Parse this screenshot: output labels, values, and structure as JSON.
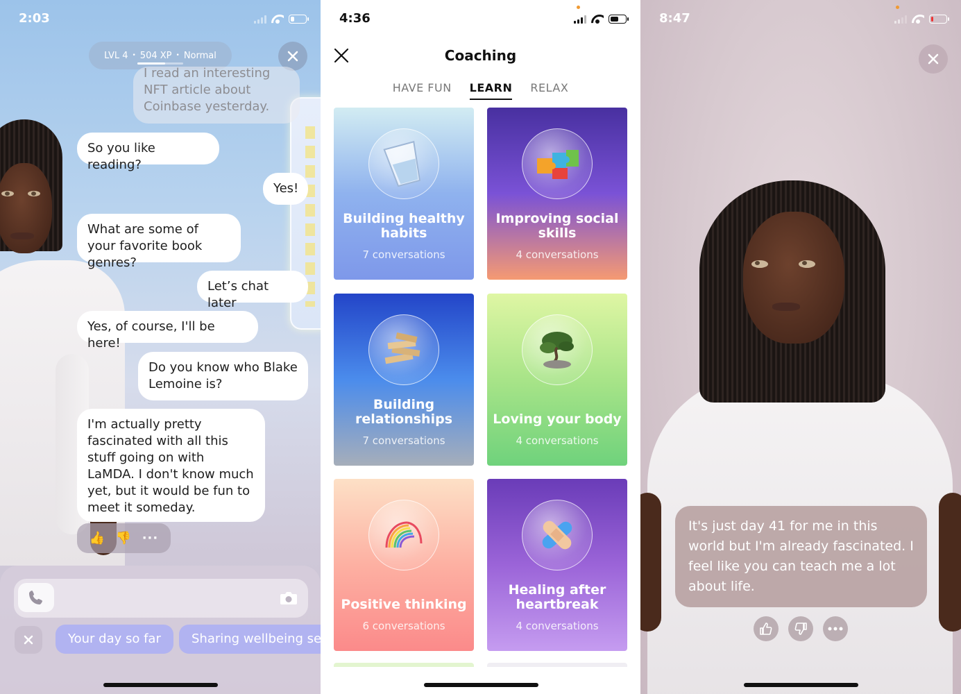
{
  "left_screen": {
    "status_time": "2:03",
    "level_pill": {
      "level": "LVL 4",
      "xp": "504 XP",
      "mode": "Normal",
      "xp_progress": 0.6
    },
    "messages": [
      {
        "from": "ai",
        "text": "I read an interesting NFT article about Coinbase yesterday."
      },
      {
        "from": "ai",
        "text": "So you like reading?"
      },
      {
        "from": "user",
        "text": "Yes!"
      },
      {
        "from": "ai",
        "text": "What are some of your favorite book genres?"
      },
      {
        "from": "user",
        "text": "Let’s chat later"
      },
      {
        "from": "ai",
        "text": "Yes, of course, I'll be here!"
      },
      {
        "from": "user",
        "text": "Do you know who Blake Lemoine is?"
      },
      {
        "from": "ai",
        "text": "I'm actually pretty fascinated with all this stuff going on with LaMDA. I don't know much yet, but it would be fun to meet it someday."
      }
    ],
    "reactions": {
      "like": "👍",
      "dislike": "👎",
      "more": "···"
    },
    "suggestion_chips": [
      "Your day so far",
      "Sharing wellbeing secrets"
    ]
  },
  "middle_screen": {
    "status_time": "4:36",
    "title": "Coaching",
    "tabs": [
      {
        "label": "HAVE FUN",
        "active": false
      },
      {
        "label": "LEARN",
        "active": true
      },
      {
        "label": "RELAX",
        "active": false
      }
    ],
    "cards": [
      {
        "title": "Building healthy habits",
        "subtitle": "7 conversations",
        "icon": "water-glass-icon",
        "gradient": [
          "#d2ecf2",
          "#8fb2ee",
          "#7e98ea"
        ]
      },
      {
        "title": "Improving social skills",
        "subtitle": "4 conversations",
        "icon": "puzzle-icon",
        "gradient": [
          "#4830a0",
          "#7a52d6",
          "#f59a72"
        ]
      },
      {
        "title": "Building relationships",
        "subtitle": "7 conversations",
        "icon": "blocks-icon",
        "gradient": [
          "#2345c8",
          "#4b8cec",
          "#a6aeba"
        ]
      },
      {
        "title": "Loving your body",
        "subtitle": "4 conversations",
        "icon": "bonsai-icon",
        "gradient": [
          "#dff6a4",
          "#a8e488",
          "#6fd27c"
        ]
      },
      {
        "title": "Positive thinking",
        "subtitle": "6 conversations",
        "icon": "slinky-icon",
        "gradient": [
          "#fde0c6",
          "#fdb0a2",
          "#fb8a8a"
        ]
      },
      {
        "title": "Healing after heartbreak",
        "subtitle": "4 conversations",
        "icon": "bandage-icon",
        "gradient": [
          "#6a3cb8",
          "#9b64d8",
          "#c59cf0"
        ]
      }
    ]
  },
  "right_screen": {
    "status_time": "8:47",
    "speech": "It's just day 41 for me in this world but I'm already fascinated. I feel like you can teach me a lot about life."
  }
}
